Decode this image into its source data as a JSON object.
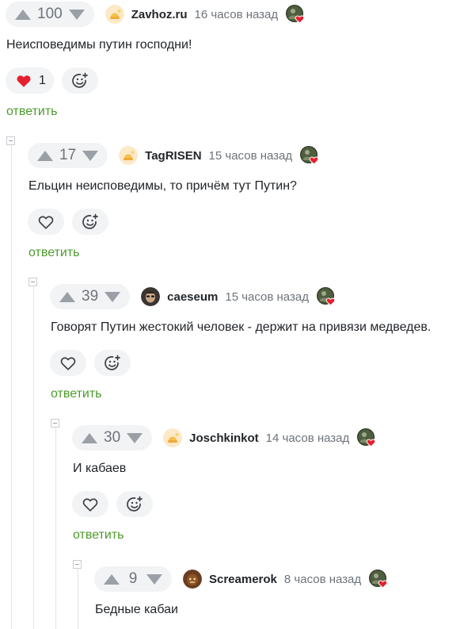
{
  "colors": {
    "reply_link": "#4d9a2c",
    "heart_active": "#e5202e",
    "rating_bg": "#f1f3f5"
  },
  "icons": {
    "upvote": "arrow-up-icon",
    "downvote": "arrow-down-icon",
    "like": "heart-icon",
    "reaction": "emoji-add-icon",
    "collapse": "collapse-minus-icon",
    "badge": "user-badge-heart-icon"
  },
  "comments": [
    {
      "rating": "100",
      "username": "Zavhoz.ru",
      "time": "16 часов назад",
      "text": "Неисповедимы путин господни!",
      "likes": "1",
      "reply_label": "ответить"
    },
    {
      "rating": "17",
      "username": "TagRISEN",
      "time": "15 часов назад",
      "text": "Ельцин неисповедимы, то причём тут Путин?",
      "reply_label": "ответить"
    },
    {
      "rating": "39",
      "username": "caeseum",
      "time": "15 часов назад",
      "text": "Говорят Путин жестокий человек - держит на привязи медведев.",
      "reply_label": "ответить"
    },
    {
      "rating": "30",
      "username": "Joschkinkot",
      "time": "14 часов назад",
      "text": "И кабаев",
      "reply_label": "ответить"
    },
    {
      "rating": "9",
      "username": "Screamerok",
      "time": "8 часов назад",
      "text": "Бедные кабаи"
    }
  ]
}
